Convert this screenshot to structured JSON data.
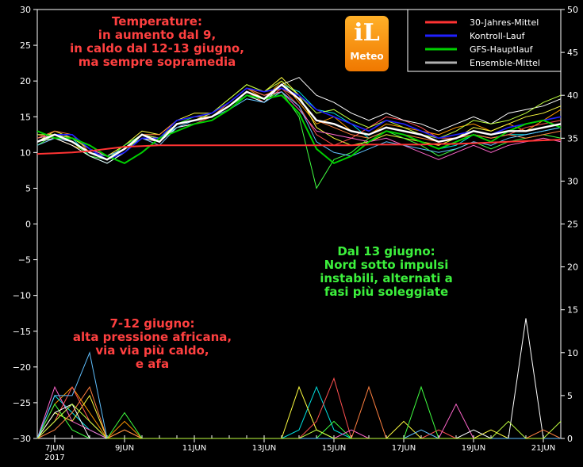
{
  "chart_data": {
    "type": "line",
    "x_dates": [
      "7JUN",
      "9JUN",
      "11JUN",
      "13JUN",
      "15JUN",
      "17JUN",
      "19JUN",
      "21JUN"
    ],
    "year_label": "2017",
    "left_axis": {
      "ticks": [
        30,
        25,
        20,
        15,
        10,
        5,
        0,
        -5,
        -10,
        -15,
        -20,
        -25,
        -30
      ],
      "range": [
        -30,
        30
      ]
    },
    "right_axis": {
      "ticks": [
        50,
        45,
        40,
        35,
        30,
        25,
        20,
        15,
        10,
        5,
        0
      ],
      "range": [
        0,
        50
      ]
    },
    "legend": [
      {
        "name": "30-Jahres-Mittel",
        "color": "#ff3333"
      },
      {
        "name": "Kontroll-Lauf",
        "color": "#2020ff"
      },
      {
        "name": "GFS-Hauptlauf",
        "color": "#00d000"
      },
      {
        "name": "Ensemble-Mittel",
        "color": "#b0b0b0"
      }
    ],
    "temperature": {
      "climate_mean": [
        9.8,
        9.9,
        10.0,
        10.2,
        10.5,
        10.8,
        10.9,
        11.0,
        11.0,
        11.0,
        11.0,
        11.0,
        11.0,
        11.0,
        11.0,
        11.0,
        11.0,
        11.0,
        11.0,
        11.1,
        11.1,
        11.1,
        11.1,
        11.2,
        11.2,
        11.3,
        11.4,
        11.5,
        11.6,
        11.7,
        11.8
      ],
      "ensemble_mean": [
        11.5,
        12.5,
        11.5,
        10.0,
        9.0,
        10.5,
        12.5,
        11.5,
        14.0,
        14.5,
        15.0,
        16.5,
        18.5,
        17.5,
        19.5,
        17.5,
        14.5,
        14.0,
        13.0,
        12.5,
        13.5,
        13.0,
        12.5,
        11.5,
        12.0,
        13.0,
        12.5,
        13.0,
        13.0,
        13.5,
        14.0
      ],
      "gfs_main": [
        13.0,
        12.0,
        12.0,
        11.0,
        9.5,
        8.5,
        10.0,
        12.0,
        13.0,
        14.0,
        14.5,
        16.0,
        18.0,
        17.5,
        18.0,
        15.5,
        10.5,
        8.5,
        9.5,
        11.5,
        13.0,
        12.5,
        11.5,
        10.5,
        11.5,
        12.5,
        11.5,
        13.0,
        14.0,
        14.5,
        13.5
      ],
      "control_run": [
        11.5,
        12.5,
        12.5,
        10.5,
        9.0,
        10.0,
        12.0,
        12.0,
        14.5,
        15.0,
        15.5,
        17.0,
        19.0,
        18.5,
        19.0,
        18.0,
        16.0,
        15.0,
        14.0,
        13.0,
        14.5,
        14.0,
        13.0,
        12.0,
        12.5,
        13.0,
        12.5,
        13.5,
        14.0,
        14.5,
        15.0
      ],
      "members": [
        [
          11.0,
          12.0,
          11.0,
          10.0,
          9.5,
          10.5,
          12.0,
          11.5,
          14.0,
          14.5,
          15.5,
          17.0,
          19.0,
          17.5,
          20.0,
          17.0,
          14.0,
          15.0,
          13.0,
          12.5,
          14.0,
          13.5,
          13.0,
          12.5,
          13.5,
          14.0,
          13.0,
          14.0,
          13.0,
          14.5,
          16.0
        ],
        [
          12.0,
          12.5,
          12.0,
          9.5,
          8.5,
          10.0,
          12.5,
          12.0,
          13.5,
          14.0,
          14.5,
          16.0,
          18.0,
          17.0,
          19.5,
          18.5,
          16.0,
          15.5,
          14.0,
          12.0,
          13.0,
          12.5,
          11.5,
          10.5,
          11.0,
          12.5,
          12.0,
          12.5,
          12.5,
          13.0,
          13.5
        ],
        [
          11.5,
          13.0,
          12.0,
          10.5,
          9.5,
          11.0,
          13.0,
          12.5,
          14.5,
          15.5,
          15.5,
          17.5,
          19.5,
          18.5,
          20.5,
          18.0,
          13.5,
          12.0,
          11.0,
          11.5,
          12.5,
          12.0,
          11.5,
          11.0,
          12.0,
          13.5,
          13.0,
          14.0,
          15.0,
          15.5,
          16.5
        ],
        [
          12.5,
          12.0,
          11.5,
          10.0,
          9.0,
          10.0,
          12.0,
          11.0,
          13.5,
          14.0,
          15.0,
          16.5,
          18.5,
          17.0,
          19.0,
          16.5,
          12.5,
          11.0,
          12.0,
          13.5,
          15.0,
          14.5,
          13.5,
          12.0,
          12.0,
          12.5,
          12.0,
          12.5,
          13.5,
          14.0,
          14.5
        ],
        [
          11.0,
          12.5,
          11.5,
          9.5,
          9.0,
          11.0,
          12.5,
          11.5,
          14.0,
          15.0,
          15.0,
          16.5,
          18.0,
          17.5,
          18.5,
          15.0,
          5.0,
          9.0,
          10.0,
          12.0,
          13.0,
          12.0,
          11.0,
          9.5,
          10.5,
          11.5,
          10.5,
          11.5,
          12.0,
          12.5,
          12.0
        ],
        [
          12.0,
          12.5,
          12.0,
          10.5,
          9.5,
          10.5,
          12.5,
          12.0,
          14.0,
          14.5,
          15.5,
          17.0,
          19.0,
          18.0,
          18.5,
          16.0,
          13.0,
          12.5,
          12.0,
          11.5,
          12.0,
          11.0,
          10.0,
          9.0,
          10.0,
          11.0,
          10.0,
          11.0,
          11.5,
          12.0,
          11.5
        ],
        [
          11.5,
          12.0,
          11.0,
          9.5,
          8.5,
          10.0,
          12.0,
          11.5,
          13.5,
          14.0,
          14.5,
          16.0,
          18.0,
          17.0,
          19.5,
          20.5,
          18.0,
          17.0,
          15.5,
          14.5,
          15.5,
          14.5,
          14.0,
          13.0,
          14.0,
          15.0,
          14.0,
          15.5,
          16.0,
          16.5,
          17.5
        ],
        [
          12.0,
          13.0,
          12.5,
          10.0,
          9.0,
          10.5,
          12.5,
          12.5,
          14.5,
          15.0,
          15.0,
          17.0,
          19.0,
          18.0,
          19.0,
          17.5,
          14.5,
          13.5,
          12.5,
          12.0,
          13.0,
          12.5,
          12.0,
          11.5,
          12.0,
          12.5,
          12.0,
          12.5,
          12.0,
          12.5,
          13.0
        ],
        [
          11.0,
          12.0,
          11.5,
          10.0,
          9.5,
          10.5,
          12.0,
          11.0,
          13.5,
          14.5,
          15.0,
          16.0,
          17.5,
          17.0,
          18.5,
          16.5,
          11.5,
          10.0,
          9.5,
          10.5,
          11.5,
          11.0,
          10.5,
          10.0,
          10.5,
          11.5,
          11.0,
          12.0,
          12.5,
          13.0,
          13.5
        ],
        [
          12.5,
          12.5,
          12.0,
          10.5,
          9.0,
          10.0,
          12.5,
          12.0,
          14.0,
          14.5,
          15.5,
          17.5,
          19.5,
          18.5,
          20.0,
          18.0,
          15.5,
          16.0,
          14.5,
          13.5,
          14.5,
          13.5,
          12.5,
          12.0,
          13.0,
          14.5,
          14.0,
          14.5,
          15.5,
          17.0,
          18.0
        ]
      ]
    },
    "precipitation": {
      "members": [
        [
          0,
          4,
          6,
          3,
          0,
          2,
          0,
          0,
          0,
          0,
          0,
          0,
          0,
          0,
          0,
          0,
          0,
          0,
          0,
          0,
          0,
          0,
          0,
          0,
          0,
          0,
          0,
          0,
          0,
          0,
          0
        ],
        [
          0,
          5,
          3,
          1,
          0,
          0,
          0,
          0,
          0,
          0,
          0,
          0,
          0,
          0,
          0,
          1,
          6,
          1,
          0,
          0,
          0,
          0,
          0,
          0,
          0,
          0,
          0,
          0,
          0,
          0,
          0
        ],
        [
          0,
          3,
          2,
          5,
          0,
          1,
          0,
          0,
          0,
          0,
          0,
          0,
          0,
          0,
          0,
          6,
          1,
          0,
          0,
          0,
          0,
          2,
          0,
          0,
          0,
          0,
          1,
          0,
          0,
          0,
          0
        ],
        [
          0,
          2,
          6,
          2,
          0,
          0,
          0,
          0,
          0,
          0,
          0,
          0,
          0,
          0,
          0,
          0,
          2,
          7,
          0,
          0,
          0,
          0,
          0,
          1,
          0,
          0,
          0,
          0,
          0,
          0,
          0
        ],
        [
          0,
          4,
          1,
          0,
          0,
          3,
          0,
          0,
          0,
          0,
          0,
          0,
          0,
          0,
          0,
          0,
          0,
          2,
          0,
          0,
          0,
          0,
          6,
          0,
          0,
          0,
          0,
          0,
          0,
          0,
          0
        ],
        [
          0,
          6,
          2,
          1,
          0,
          0,
          0,
          0,
          0,
          0,
          0,
          0,
          0,
          0,
          0,
          0,
          0,
          0,
          1,
          0,
          0,
          0,
          0,
          0,
          4,
          0,
          0,
          0,
          0,
          0,
          0
        ],
        [
          0,
          3,
          4,
          0,
          0,
          0,
          0,
          0,
          0,
          0,
          0,
          0,
          0,
          0,
          0,
          0,
          0,
          0,
          0,
          0,
          0,
          0,
          0,
          0,
          0,
          1,
          0,
          0,
          14,
          0,
          0
        ],
        [
          0,
          1,
          3,
          6,
          0,
          1,
          0,
          0,
          0,
          0,
          0,
          0,
          0,
          0,
          0,
          0,
          0,
          0,
          0,
          6,
          0,
          0,
          0,
          0,
          0,
          0,
          0,
          0,
          0,
          1,
          0
        ],
        [
          0,
          5,
          5,
          10,
          0,
          0,
          0,
          0,
          0,
          0,
          0,
          0,
          0,
          0,
          0,
          0,
          0,
          0,
          0,
          0,
          0,
          0,
          1,
          0,
          0,
          0,
          0,
          0,
          0,
          0,
          0
        ],
        [
          0,
          2,
          4,
          2,
          0,
          0,
          0,
          0,
          0,
          0,
          0,
          0,
          0,
          0,
          0,
          0,
          1,
          0,
          0,
          0,
          0,
          0,
          0,
          0,
          0,
          0,
          0,
          2,
          0,
          0,
          2
        ]
      ]
    }
  },
  "logo": {
    "main": "iL",
    "sub": "Meteo",
    "color": "#f28a0c"
  },
  "annotations": {
    "temp": [
      "Temperature:",
      "in aumento dal 9,",
      "in caldo dal 12-13 giugno,",
      "ma sempre sopramedia"
    ],
    "north": [
      "Dal 13 giugno:",
      "Nord sotto impulsi",
      "instabili, alternati a",
      "fasi più soleggiate"
    ],
    "june": [
      "7-12 giugno:",
      "alta pressione africana,",
      "via via più caldo,",
      "e afa"
    ],
    "temp_color": "#ff4040",
    "north_color": "#3cf03c"
  }
}
